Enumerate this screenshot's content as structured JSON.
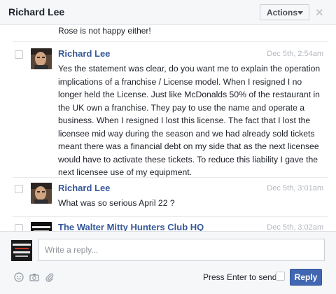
{
  "header": {
    "title": "Richard Lee",
    "actions_label": "Actions",
    "close_glyph": "✕"
  },
  "thread": {
    "previous_tail": "Rose is not happy either!",
    "messages": [
      {
        "sender": "Richard Lee",
        "time": "Dec 5th, 2:54am",
        "avatar": "richard-lee-photo",
        "lines": [
          "Yes the statement was clear, do you want me to explain the operation",
          "implications of a franchise / License model. When I resigned I no",
          "longer held the License. Just like McDonalds 50% of the restaurant in",
          "the UK own a franchise. They pay to use the name and operate a",
          "business. When I resigned I lost this license. The fact that I lost the",
          "licensee mid way during the season and we had already sold tickets",
          "meant there was a financial debt on my side that as the next licensee",
          "would have to activate these tickets. To reduce this liability I gave the",
          "next licensee use of my equipment."
        ]
      },
      {
        "sender": "Richard Lee",
        "time": "Dec 5th, 3:01am",
        "avatar": "richard-lee-photo",
        "lines": [
          "What was so serious April 22 ?"
        ]
      },
      {
        "sender": "The Walter Mitty Hunters Club HQ",
        "time": "Dec 5th, 3:02am",
        "avatar": "walter-mitty-logo",
        "lines": []
      }
    ]
  },
  "reply": {
    "placeholder": "Write a reply...",
    "press_enter_label": "Press Enter to send",
    "reply_label": "Reply",
    "icons": [
      "emoji-icon",
      "camera-icon",
      "attachment-icon"
    ]
  },
  "colors": {
    "link": "#365899",
    "button": "#4267b2",
    "timestamp": "#b4b8bf"
  }
}
